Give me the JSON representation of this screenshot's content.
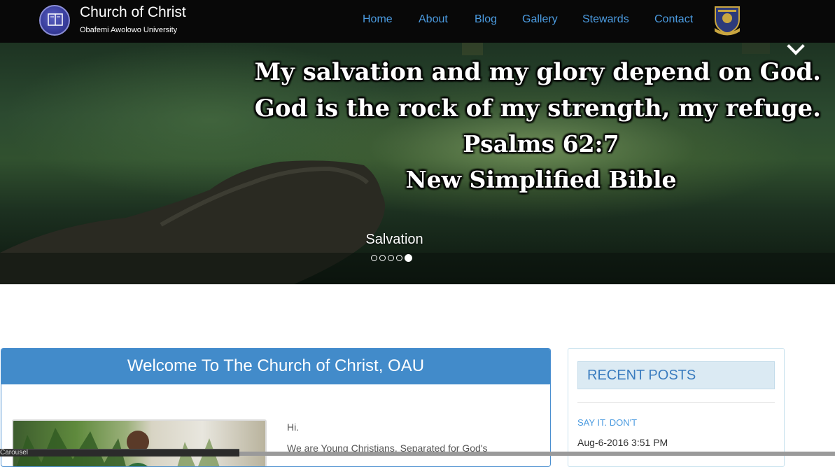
{
  "brand": {
    "title": "Church of Christ",
    "subtitle": "Obafemi Awolowo University",
    "logo_icon": "open-bible-icon",
    "crest_icon": "university-crest-icon"
  },
  "nav": {
    "items": [
      {
        "label": "Home"
      },
      {
        "label": "About"
      },
      {
        "label": "Blog"
      },
      {
        "label": "Gallery"
      },
      {
        "label": "Stewards"
      },
      {
        "label": "Contact"
      }
    ],
    "link_color": "#4b9be0"
  },
  "carousel": {
    "quote": {
      "line1": "My salvation and my glory depend on God.",
      "line2": "God is the rock of my strength, my refuge.",
      "reference": "Psalms 62:7",
      "version": "New Simplified Bible"
    },
    "caption": "Salvation",
    "slide_count": 5,
    "active_slide": 5,
    "next_icon": "chevron-right-icon"
  },
  "welcome": {
    "heading": "Welcome To The Church of Christ, OAU",
    "greeting": "Hi.",
    "intro": "We are Young Christians, Separated for God's",
    "accent": "#428bca"
  },
  "recent_posts": {
    "heading": "RECENT POSTS",
    "posts": [
      {
        "title": "SAY IT. DON'T",
        "date": "Aug-6-2016 3:51 PM"
      }
    ]
  },
  "status_bar": {
    "text": "Carousel"
  }
}
